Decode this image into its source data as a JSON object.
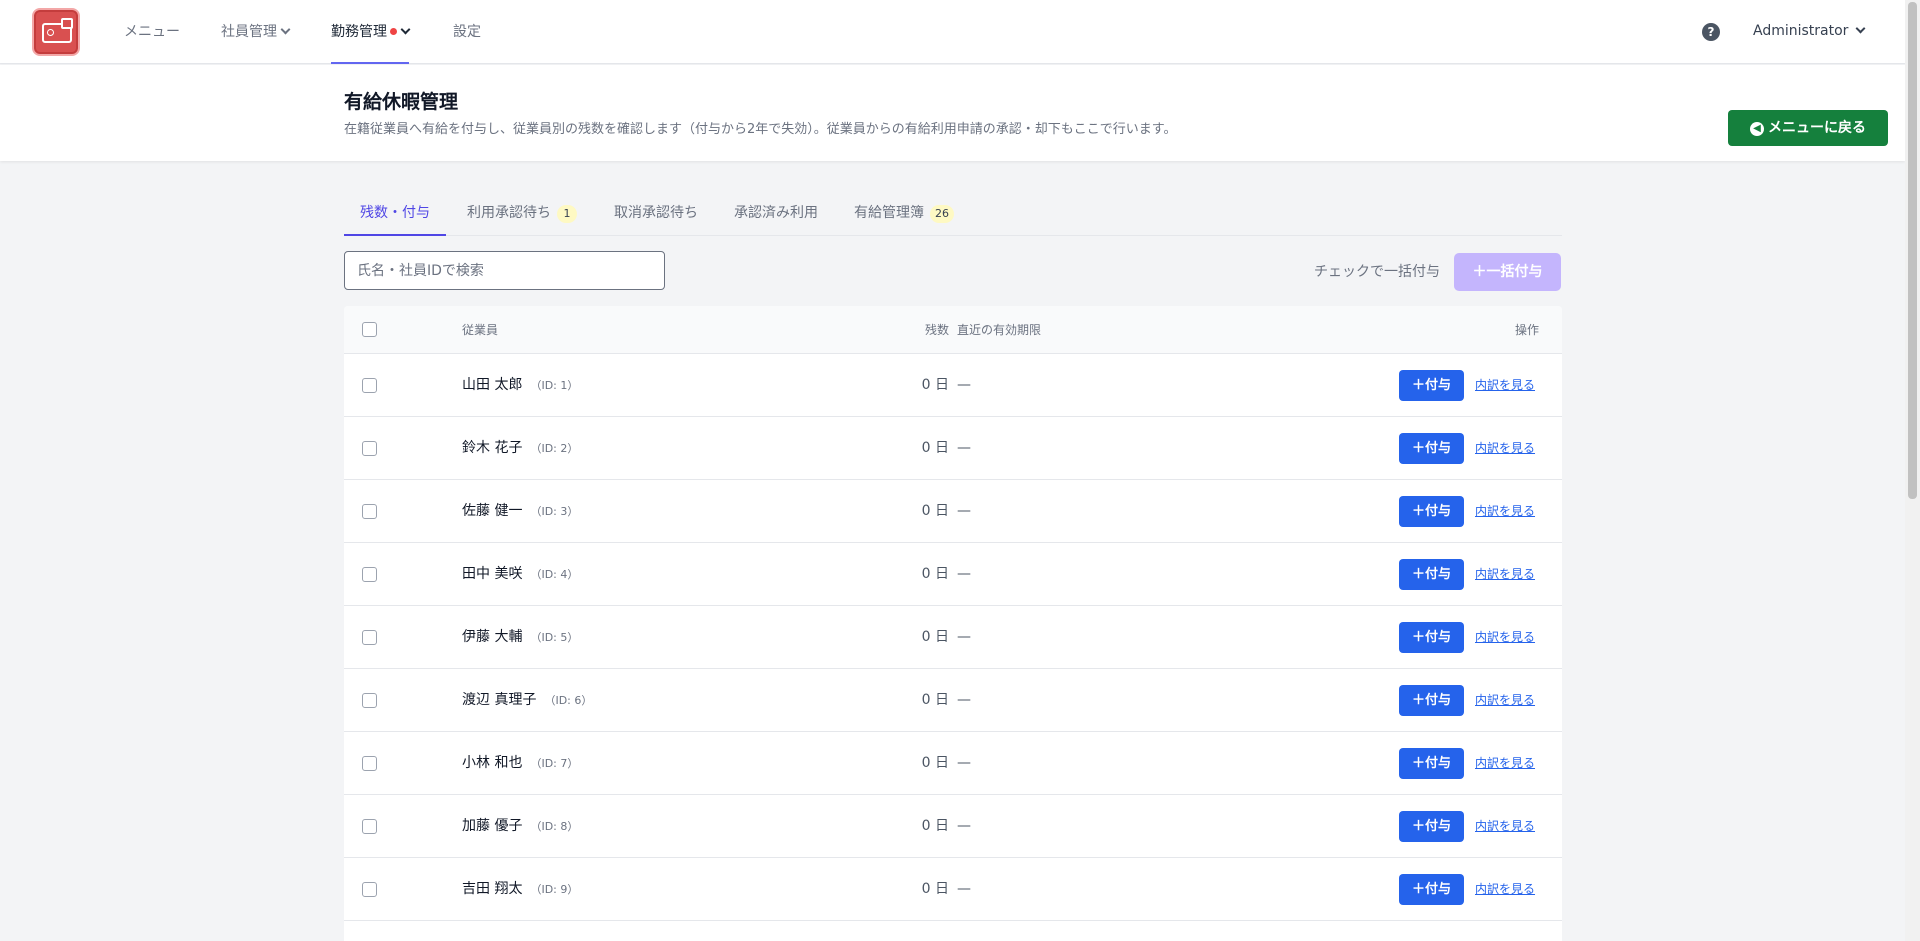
{
  "nav": {
    "items": [
      {
        "label": "メニュー"
      },
      {
        "label": "社員管理"
      },
      {
        "label": "勤務管理"
      },
      {
        "label": "設定"
      }
    ],
    "help": "?",
    "user": "Administrator"
  },
  "header": {
    "title": "有給休暇管理",
    "description": "在籍従業員へ有給を付与し、従業員別の残数を確認します（付与から2年で失効）。従業員からの有給利用申請の承認・却下もここで行います。",
    "back_button": "メニューに戻る"
  },
  "tabs": [
    {
      "label": "残数・付与",
      "active": true
    },
    {
      "label": "利用承認待ち",
      "badge": "1"
    },
    {
      "label": "取消承認待ち"
    },
    {
      "label": "承認済み利用"
    },
    {
      "label": "有給管理簿",
      "badge": "26"
    }
  ],
  "toolbar": {
    "search_placeholder": "氏名・社員IDで検索",
    "bulk_label": "チェックで一括付与",
    "bulk_button": "一括付与"
  },
  "table": {
    "headers": {
      "employee": "従業員",
      "remaining": "残数",
      "expiry": "直近の有効期限",
      "actions": "操作"
    },
    "rows": [
      {
        "name": "山田 太郎",
        "id": "（ID: 1）",
        "days": "0 日",
        "expiry": "—"
      },
      {
        "name": "鈴木 花子",
        "id": "（ID: 2）",
        "days": "0 日",
        "expiry": "—"
      },
      {
        "name": "佐藤 健一",
        "id": "（ID: 3）",
        "days": "0 日",
        "expiry": "—"
      },
      {
        "name": "田中 美咲",
        "id": "（ID: 4）",
        "days": "0 日",
        "expiry": "—"
      },
      {
        "name": "伊藤 大輔",
        "id": "（ID: 5）",
        "days": "0 日",
        "expiry": "—"
      },
      {
        "name": "渡辺 真理子",
        "id": "（ID: 6）",
        "days": "0 日",
        "expiry": "—"
      },
      {
        "name": "小林 和也",
        "id": "（ID: 7）",
        "days": "0 日",
        "expiry": "—"
      },
      {
        "name": "加藤 優子",
        "id": "（ID: 8）",
        "days": "0 日",
        "expiry": "—"
      },
      {
        "name": "吉田 翔太",
        "id": "（ID: 9）",
        "days": "0 日",
        "expiry": "—"
      }
    ],
    "grant_button": "付与",
    "detail_link": "内訳を見る"
  },
  "colors": {
    "accent": "#4f46e5",
    "primary_button": "#2563eb",
    "back_button": "#15803d",
    "logo": "#d95050",
    "badge": "#fef9c3"
  }
}
